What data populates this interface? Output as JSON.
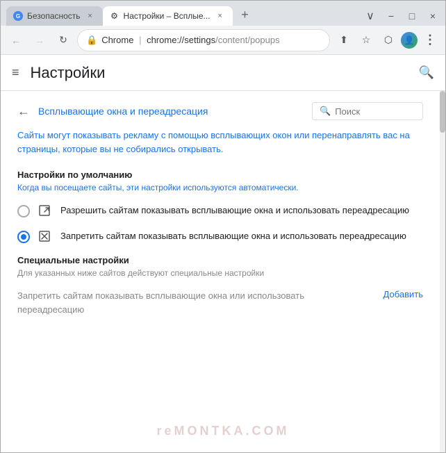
{
  "window": {
    "title": "Chrome"
  },
  "tabs": [
    {
      "id": "tab1",
      "label": "Безопасность",
      "active": false,
      "icon": "G"
    },
    {
      "id": "tab2",
      "label": "Настройки – Всплые...",
      "active": true,
      "icon": "⚙"
    }
  ],
  "new_tab_label": "+",
  "window_controls": {
    "minimize": "−",
    "maximize": "□",
    "close": "×"
  },
  "address_bar": {
    "secure_icon": "🔒",
    "browser_name": "Chrome",
    "separator": "|",
    "url_domain": "chrome://settings",
    "url_path": "/content/popups",
    "share_icon": "share",
    "star_icon": "★",
    "extensions_icon": "□",
    "profile_icon": "👤",
    "menu_icon": "⋮"
  },
  "nav_buttons": {
    "back": "←",
    "forward": "→",
    "refresh": "↻"
  },
  "header": {
    "menu_icon": "≡",
    "title": "Настройки",
    "search_icon": "🔍"
  },
  "section": {
    "back_icon": "←",
    "title": "Всплывающие окна и переадресация",
    "search_placeholder": "Поиск"
  },
  "description": "Сайты могут показывать рекламу с помощью всплывающих окон или перенаправлять вас на страницы, которые вы не собирались открывать.",
  "defaults": {
    "title": "Настройки по умолчанию",
    "description": "Когда вы посещаете сайты, эти настройки используются автоматически."
  },
  "options": [
    {
      "id": "allow",
      "selected": false,
      "icon": "□↗",
      "label": "Разрешить сайтам показывать всплывающие окна и использовать переадресацию"
    },
    {
      "id": "block",
      "selected": true,
      "icon": "□✕",
      "label": "Запретить сайтам показывать всплывающие окна и использовать переадресацию"
    }
  ],
  "special": {
    "title": "Специальные настройки",
    "description": "Для указанных ниже сайтов действуют специальные настройки"
  },
  "add_row": {
    "text": "Запретить сайтам показывать всплывающие окна или использовать переадресацию",
    "button_label": "Добавить"
  },
  "watermark": "reMONTKA.COM"
}
